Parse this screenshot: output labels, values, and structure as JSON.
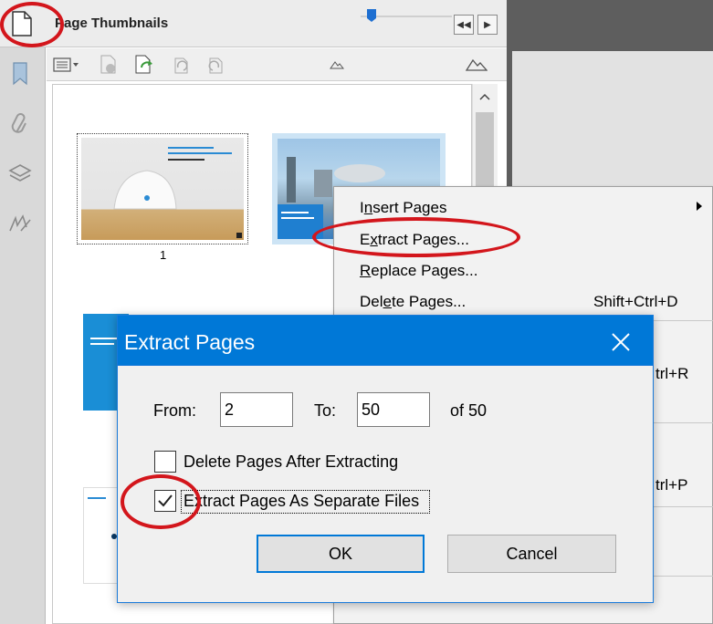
{
  "panel": {
    "title": "Page Thumbnails",
    "nav_collapse_glyph": "◀◀",
    "nav_expand_glyph": "▶"
  },
  "thumbnails": [
    {
      "label": "1"
    }
  ],
  "context_menu": {
    "items": [
      {
        "label": "Insert Pages",
        "mnemonic_index": 1,
        "has_submenu": true
      },
      {
        "label": "Extract Pages...",
        "mnemonic_index": 1
      },
      {
        "label": "Replace Pages...",
        "mnemonic_index": 0
      },
      {
        "label": "Delete Pages...",
        "mnemonic_index": 3,
        "shortcut": "Shift+Ctrl+D"
      }
    ],
    "partial_shortcuts": [
      "trl+R",
      "trl+P"
    ]
  },
  "dialog": {
    "title": "Extract Pages",
    "from_label": "From:",
    "from_value": "2",
    "to_label": "To:",
    "to_value": "50",
    "of_text": "of 50",
    "delete_after_label": "Delete Pages After Extracting",
    "delete_after_checked": false,
    "separate_files_label": "Extract Pages As Separate Files",
    "separate_files_checked": true,
    "ok_label": "OK",
    "cancel_label": "Cancel"
  },
  "colors": {
    "annotation_red": "#d3161c",
    "dialog_titlebar": "#0078d7"
  }
}
